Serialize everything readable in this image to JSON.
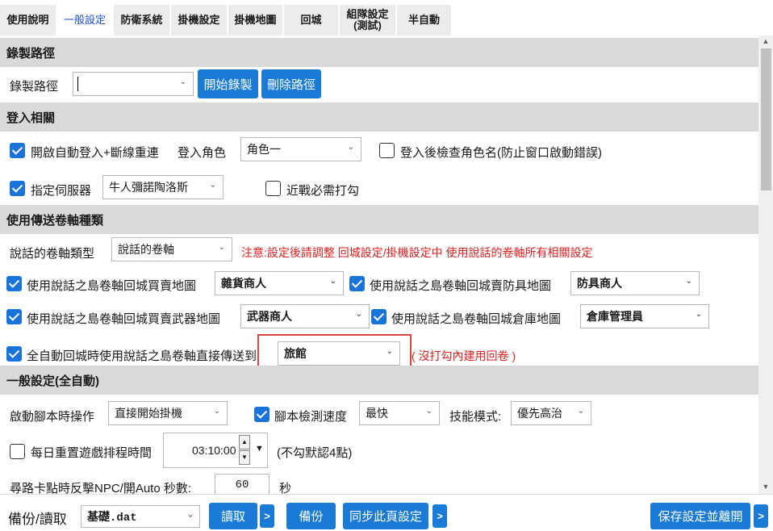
{
  "tabs": [
    {
      "label": "使用說明",
      "active": false
    },
    {
      "label": "一般設定",
      "active": true
    },
    {
      "label": "防衛系統",
      "active": false
    },
    {
      "label": "掛機設定",
      "active": false
    },
    {
      "label": "掛機地圖",
      "active": false
    },
    {
      "label": "回城",
      "active": false
    },
    {
      "label": "組隊設定\n(測試)",
      "active": false
    },
    {
      "label": "半自動",
      "active": false
    }
  ],
  "record": {
    "header": "錄製路徑",
    "path_label": "錄製路徑",
    "path_value": "",
    "start_button": "開始錄製",
    "delete_button": "刪除路徑"
  },
  "login": {
    "header": "登入相關",
    "auto_login_label": "開啟自動登入+斷線重連",
    "auto_login_checked": true,
    "role_label": "登入角色",
    "role_value": "角色一",
    "check_name_label": "登入後檢查角色名(防止窗口啟動錯誤)",
    "check_name_checked": false,
    "server_label": "指定伺服器",
    "server_checked": true,
    "server_value": "牛人彌諾陶洛斯",
    "melee_label": "近戰必需打勾",
    "melee_checked": false
  },
  "scroll": {
    "header": "使用傳送卷軸種類",
    "type_label": "說話的卷軸類型",
    "type_value": "說話的卷軸",
    "note": "注意:設定後請調整 回城設定/掛機設定中 使用說話的卷軸所有相關設定",
    "grocery_label": "使用說話之島卷軸回城買賣地圖",
    "grocery_value": "雜貨商人",
    "armor_label": "使用說話之島卷軸回城賣防具地圖",
    "armor_value": "防具商人",
    "weapon_label": "使用說話之島卷軸回城買賣武器地圖",
    "weapon_value": "武器商人",
    "warehouse_label": "使用說話之島卷軸回城倉庫地圖",
    "warehouse_value": "倉庫管理員",
    "direct_label": "全自動回城時使用說話之島卷軸直接傳送到",
    "direct_value": "旅館",
    "direct_note": "( 沒打勾內建用回卷 )"
  },
  "general": {
    "header": "一般設定(全自動)",
    "start_action_label": "啟動腳本時操作",
    "start_action_value": "直接開始掛機",
    "detect_speed_label": "腳本檢測速度",
    "detect_speed_checked": true,
    "detect_speed_value": "最快",
    "skill_mode_label": "技能模式:",
    "skill_mode_value": "優先高治",
    "daily_reset_label": "每日重置遊戲排程時間",
    "daily_reset_checked": false,
    "daily_reset_time": "03:10:00",
    "daily_reset_note": "(不勾默認4點)",
    "stuck_label": "尋路卡點時反擊NPC/開Auto 秒數:",
    "stuck_value": "60",
    "stuck_unit": "秒"
  },
  "footer": {
    "backup_label": "備份/讀取",
    "file_value": "基礎.dat",
    "read_button": "讀取",
    "more_1": ">",
    "backup_button": "備份",
    "sync_button": "同步此頁設定",
    "more_2": ">",
    "save_exit_button": "保存設定並離開",
    "more_3": ">"
  },
  "colors": {
    "accent_blue": "#1a7bd6",
    "active_tab_text": "#1e4fcf",
    "section_header_bg": "#d9d9d9",
    "warning_red": "#e01e1e"
  }
}
